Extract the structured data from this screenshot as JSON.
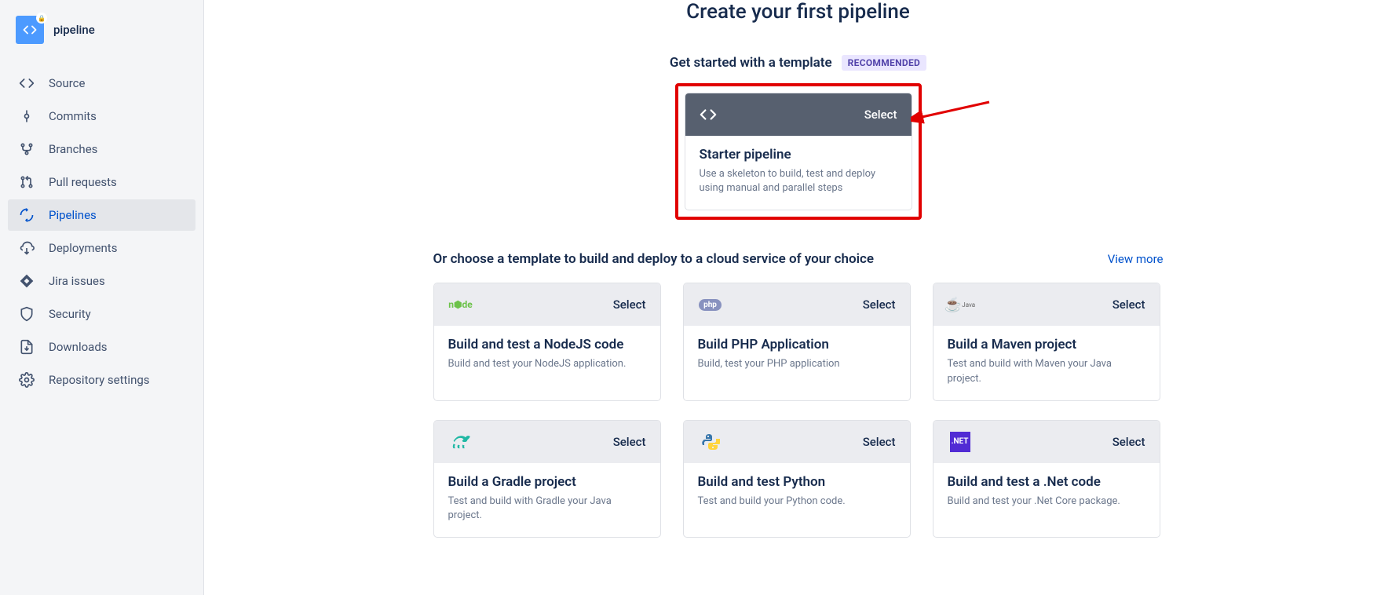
{
  "project": {
    "name": "pipeline"
  },
  "sidebar": {
    "items": [
      {
        "id": "source",
        "label": "Source"
      },
      {
        "id": "commits",
        "label": "Commits"
      },
      {
        "id": "branches",
        "label": "Branches"
      },
      {
        "id": "pull-requests",
        "label": "Pull requests"
      },
      {
        "id": "pipelines",
        "label": "Pipelines"
      },
      {
        "id": "deployments",
        "label": "Deployments"
      },
      {
        "id": "jira-issues",
        "label": "Jira issues"
      },
      {
        "id": "security",
        "label": "Security"
      },
      {
        "id": "downloads",
        "label": "Downloads"
      },
      {
        "id": "repo-settings",
        "label": "Repository settings"
      }
    ]
  },
  "page": {
    "title": "Create your first pipeline"
  },
  "featured": {
    "section_label": "Get started with a template",
    "badge": "RECOMMENDED",
    "select_label": "Select",
    "title": "Starter pipeline",
    "description": "Use a skeleton to build, test and deploy using manual and parallel steps"
  },
  "templates": {
    "section_label": "Or choose a template to build and deploy to a cloud service of your choice",
    "view_more": "View more",
    "items": [
      {
        "icon": "node",
        "select_label": "Select",
        "title": "Build and test a NodeJS code",
        "desc": "Build and test your NodeJS application."
      },
      {
        "icon": "php",
        "select_label": "Select",
        "title": "Build PHP Application",
        "desc": "Build, test your PHP application"
      },
      {
        "icon": "maven",
        "select_label": "Select",
        "title": "Build a Maven project",
        "desc": "Test and build with Maven your Java project."
      },
      {
        "icon": "gradle",
        "select_label": "Select",
        "title": "Build a Gradle project",
        "desc": "Test and build with Gradle your Java project."
      },
      {
        "icon": "python",
        "select_label": "Select",
        "title": "Build and test Python",
        "desc": "Test and build your Python code."
      },
      {
        "icon": "net",
        "select_label": "Select",
        "title": "Build and test a .Net code",
        "desc": "Build and test your .Net Core package."
      }
    ]
  }
}
